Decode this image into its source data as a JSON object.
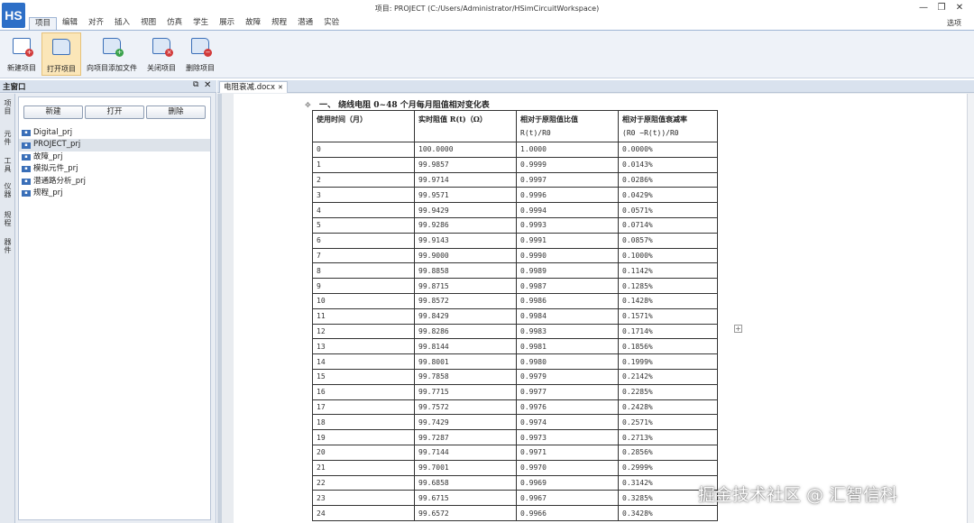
{
  "window": {
    "logo": "HS",
    "title": "项目: PROJECT (C:/Users/Administrator/HSimCircuitWorkspace)",
    "min_glyph": "—",
    "max_glyph": "❐",
    "close_glyph": "✕"
  },
  "menu": {
    "items": [
      "项目",
      "编辑",
      "对齐",
      "插入",
      "视图",
      "仿真",
      "学生",
      "展示",
      "故障",
      "规程",
      "潜通",
      "实验"
    ],
    "right": "选项"
  },
  "ribbon": {
    "buttons": [
      "新建项目",
      "打开项目",
      "向项目添加文件",
      "关闭项目",
      "删除项目"
    ]
  },
  "left_panel": {
    "title": "主窗口",
    "pin_glyph": "⧉",
    "close_glyph": "✕",
    "vtabs": [
      "项目",
      "元件",
      "工具",
      "仪器",
      "规程",
      "器件"
    ],
    "buttons": {
      "new": "新建",
      "open": "打开",
      "delete": "删除"
    },
    "projects": [
      "Digital_prj",
      "PROJECT_prj",
      "故障_prj",
      "模拟元件_prj",
      "潜通路分析_prj",
      "规程_prj"
    ],
    "selected_index": 1
  },
  "document": {
    "tab_name": "电阻衰减.docx",
    "tab_close": "✕",
    "table_title": "一、  绕线电阻 0~48 个月每月阻值相对变化表",
    "headers": [
      {
        "line1": "使用时间（月）",
        "line2": ""
      },
      {
        "line1": "实时阻值 R(t)（Ω）",
        "line2": ""
      },
      {
        "line1": "相对于原阻值比值",
        "line2": "R(t)/R0"
      },
      {
        "line1": "相对于原阻值衰减率",
        "line2": "(R0  −R(t))/R0"
      }
    ],
    "rows": [
      [
        "0",
        "100.0000",
        "1.0000",
        "0.0000%"
      ],
      [
        "1",
        "99.9857",
        "0.9999",
        "0.0143%"
      ],
      [
        "2",
        "99.9714",
        "0.9997",
        "0.0286%"
      ],
      [
        "3",
        "99.9571",
        "0.9996",
        "0.0429%"
      ],
      [
        "4",
        "99.9429",
        "0.9994",
        "0.0571%"
      ],
      [
        "5",
        "99.9286",
        "0.9993",
        "0.0714%"
      ],
      [
        "6",
        "99.9143",
        "0.9991",
        "0.0857%"
      ],
      [
        "7",
        "99.9000",
        "0.9990",
        "0.1000%"
      ],
      [
        "8",
        "99.8858",
        "0.9989",
        "0.1142%"
      ],
      [
        "9",
        "99.8715",
        "0.9987",
        "0.1285%"
      ],
      [
        "10",
        "99.8572",
        "0.9986",
        "0.1428%"
      ],
      [
        "11",
        "99.8429",
        "0.9984",
        "0.1571%"
      ],
      [
        "12",
        "99.8286",
        "0.9983",
        "0.1714%"
      ],
      [
        "13",
        "99.8144",
        "0.9981",
        "0.1856%"
      ],
      [
        "14",
        "99.8001",
        "0.9980",
        "0.1999%"
      ],
      [
        "15",
        "99.7858",
        "0.9979",
        "0.2142%"
      ],
      [
        "16",
        "99.7715",
        "0.9977",
        "0.2285%"
      ],
      [
        "17",
        "99.7572",
        "0.9976",
        "0.2428%"
      ],
      [
        "18",
        "99.7429",
        "0.9974",
        "0.2571%"
      ],
      [
        "19",
        "99.7287",
        "0.9973",
        "0.2713%"
      ],
      [
        "20",
        "99.7144",
        "0.9971",
        "0.2856%"
      ],
      [
        "21",
        "99.7001",
        "0.9970",
        "0.2999%"
      ],
      [
        "22",
        "99.6858",
        "0.9969",
        "0.3142%"
      ],
      [
        "23",
        "99.6715",
        "0.9967",
        "0.3285%"
      ],
      [
        "24",
        "99.6572",
        "0.9966",
        "0.3428%"
      ]
    ]
  },
  "watermark": "掘金技术社区 @ 汇智信科"
}
